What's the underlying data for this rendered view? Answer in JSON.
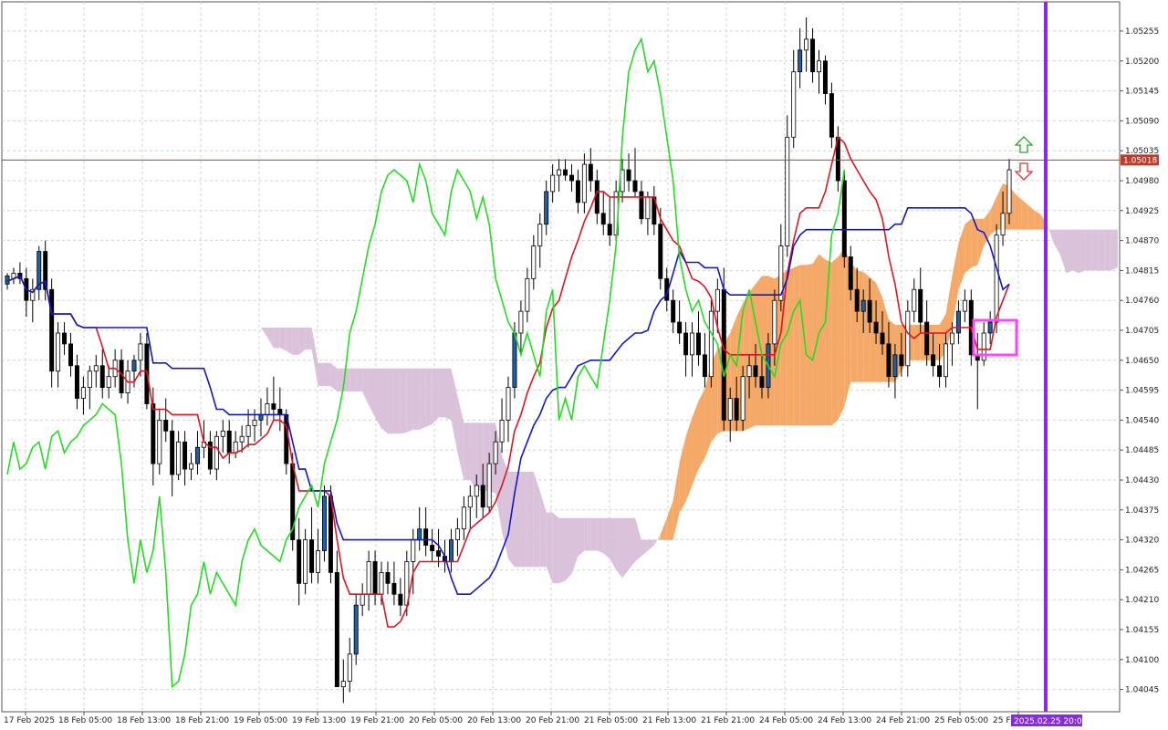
{
  "chart_data": {
    "type": "candlestick",
    "y_ticks": [
      "1.05255",
      "1.05200",
      "1.05145",
      "1.05090",
      "1.05035",
      "1.04980",
      "1.04925",
      "1.04870",
      "1.04815",
      "1.04760",
      "1.04705",
      "1.04650",
      "1.04595",
      "1.04540",
      "1.04485",
      "1.04430",
      "1.04375",
      "1.04320",
      "1.04265",
      "1.04210",
      "1.04155",
      "1.04100",
      "1.04045"
    ],
    "x_tick_labels": [
      "17 Feb 2025",
      "18 Feb 05:00",
      "18 Feb 13:00",
      "18 Feb 21:00",
      "19 Feb 05:00",
      "19 Feb 13:00",
      "19 Feb 21:00",
      "20 Feb 05:00",
      "20 Feb 13:00",
      "20 Feb 21:00",
      "21 Feb 05:00",
      "21 Feb 13:00",
      "21 Feb 21:00",
      "24 Feb 05:00",
      "24 Feb 13:00",
      "24 Feb 21:00",
      "25 Feb 05:00",
      "25 F"
    ],
    "ylim": [
      1.04,
      1.053
    ],
    "current_price": "1.05018",
    "current_time_label": "2025.02.25 20:00",
    "colors": {
      "bull": "#ffffff",
      "bear": "#000000",
      "bull_blue": "#1f5fa8",
      "kumo_bull": "#f4a460",
      "kumo_bear": "#d8bfd8",
      "tenkan": "#e0141e",
      "kijun": "#1018c8",
      "chikou": "#22dd22",
      "price_line": "#c0392b",
      "current_time_line": "#8a2be2",
      "highlight_box": "#ff44ff",
      "up_arrow": "#22aa22",
      "down_arrow": "#e03030"
    },
    "candles": [
      [
        1.0479,
        1.0481,
        1.0478,
        1.04805
      ],
      [
        1.048,
        1.0482,
        1.0479,
        1.0481
      ],
      [
        1.0481,
        1.0483,
        1.0479,
        1.048
      ],
      [
        1.048,
        1.0482,
        1.0473,
        1.0476
      ],
      [
        1.0476,
        1.048,
        1.0472,
        1.0478
      ],
      [
        1.0478,
        1.0486,
        1.0476,
        1.0485
      ],
      [
        1.0485,
        1.0487,
        1.0476,
        1.0478
      ],
      [
        1.0478,
        1.048,
        1.046,
        1.0463
      ],
      [
        1.0463,
        1.0472,
        1.046,
        1.047
      ],
      [
        1.047,
        1.0472,
        1.0466,
        1.0468
      ],
      [
        1.0468,
        1.047,
        1.0462,
        1.0464
      ],
      [
        1.0464,
        1.0466,
        1.0456,
        1.0458
      ],
      [
        1.0458,
        1.0462,
        1.0455,
        1.046
      ],
      [
        1.046,
        1.0464,
        1.0456,
        1.0463
      ],
      [
        1.0463,
        1.0466,
        1.046,
        1.0464
      ],
      [
        1.0464,
        1.0467,
        1.0458,
        1.046
      ],
      [
        1.046,
        1.0464,
        1.0458,
        1.0462
      ],
      [
        1.0462,
        1.0467,
        1.046,
        1.0465
      ],
      [
        1.0465,
        1.0467,
        1.0458,
        1.0459
      ],
      [
        1.0459,
        1.0465,
        1.0457,
        1.0463
      ],
      [
        1.0463,
        1.0466,
        1.046,
        1.0465
      ],
      [
        1.0465,
        1.047,
        1.0462,
        1.0468
      ],
      [
        1.0468,
        1.047,
        1.0456,
        1.0457
      ],
      [
        1.0457,
        1.046,
        1.0442,
        1.0446
      ],
      [
        1.0446,
        1.0456,
        1.0444,
        1.0454
      ],
      [
        1.0454,
        1.0458,
        1.045,
        1.0452
      ],
      [
        1.0452,
        1.0454,
        1.044,
        1.0444
      ],
      [
        1.0444,
        1.0452,
        1.0443,
        1.045
      ],
      [
        1.045,
        1.0452,
        1.0442,
        1.0445
      ],
      [
        1.0445,
        1.0448,
        1.0443,
        1.0446
      ],
      [
        1.0446,
        1.0452,
        1.0444,
        1.0449
      ],
      [
        1.0449,
        1.0454,
        1.0447,
        1.045
      ],
      [
        1.045,
        1.0452,
        1.0444,
        1.0445
      ],
      [
        1.0445,
        1.0452,
        1.0443,
        1.0451
      ],
      [
        1.0451,
        1.0454,
        1.0448,
        1.0452
      ],
      [
        1.0452,
        1.0454,
        1.0446,
        1.0448
      ],
      [
        1.0448,
        1.0452,
        1.0447,
        1.045
      ],
      [
        1.045,
        1.0453,
        1.0448,
        1.0451
      ],
      [
        1.0451,
        1.0456,
        1.0449,
        1.0453
      ],
      [
        1.0453,
        1.0456,
        1.045,
        1.0454
      ],
      [
        1.0454,
        1.0458,
        1.0451,
        1.0455
      ],
      [
        1.0455,
        1.046,
        1.0453,
        1.0457
      ],
      [
        1.0457,
        1.0462,
        1.0454,
        1.0456
      ],
      [
        1.0456,
        1.046,
        1.0452,
        1.0455
      ],
      [
        1.0455,
        1.0456,
        1.0444,
        1.0446
      ],
      [
        1.0446,
        1.0448,
        1.043,
        1.0432
      ],
      [
        1.0432,
        1.0436,
        1.042,
        1.0424
      ],
      [
        1.0424,
        1.0434,
        1.0422,
        1.0432
      ],
      [
        1.0432,
        1.0438,
        1.0424,
        1.0426
      ],
      [
        1.0426,
        1.0434,
        1.0424,
        1.043
      ],
      [
        1.043,
        1.0442,
        1.0428,
        1.044
      ],
      [
        1.044,
        1.0442,
        1.0424,
        1.0426
      ],
      [
        1.0426,
        1.043,
        1.0408,
        1.0405
      ],
      [
        1.0405,
        1.041,
        1.0402,
        1.0406
      ],
      [
        1.0406,
        1.0414,
        1.0404,
        1.0411
      ],
      [
        1.0411,
        1.0422,
        1.0409,
        1.042
      ],
      [
        1.042,
        1.0424,
        1.0418,
        1.0422
      ],
      [
        1.0422,
        1.043,
        1.0419,
        1.0428
      ],
      [
        1.0428,
        1.043,
        1.042,
        1.0422
      ],
      [
        1.0422,
        1.0428,
        1.042,
        1.0426
      ],
      [
        1.0426,
        1.0428,
        1.0422,
        1.0424
      ],
      [
        1.0424,
        1.0428,
        1.042,
        1.0422
      ],
      [
        1.0422,
        1.0425,
        1.0418,
        1.042
      ],
      [
        1.042,
        1.043,
        1.0418,
        1.0428
      ],
      [
        1.0428,
        1.0434,
        1.0422,
        1.0432
      ],
      [
        1.0432,
        1.0438,
        1.043,
        1.0434
      ],
      [
        1.0434,
        1.0438,
        1.0429,
        1.0431
      ],
      [
        1.0431,
        1.0434,
        1.0428,
        1.043
      ],
      [
        1.043,
        1.0434,
        1.0427,
        1.0429
      ],
      [
        1.0429,
        1.0432,
        1.0426,
        1.0428
      ],
      [
        1.0428,
        1.0434,
        1.0426,
        1.0432
      ],
      [
        1.0432,
        1.0436,
        1.0429,
        1.0434
      ],
      [
        1.0434,
        1.044,
        1.0432,
        1.0438
      ],
      [
        1.0438,
        1.0442,
        1.0434,
        1.044
      ],
      [
        1.044,
        1.0444,
        1.0436,
        1.0442
      ],
      [
        1.0442,
        1.0446,
        1.0436,
        1.0438
      ],
      [
        1.0438,
        1.0448,
        1.0437,
        1.0446
      ],
      [
        1.0446,
        1.0452,
        1.0444,
        1.045
      ],
      [
        1.045,
        1.0458,
        1.0448,
        1.0454
      ],
      [
        1.0454,
        1.0462,
        1.045,
        1.046
      ],
      [
        1.046,
        1.0472,
        1.0458,
        1.047
      ],
      [
        1.047,
        1.0476,
        1.0466,
        1.0474
      ],
      [
        1.0474,
        1.0482,
        1.0472,
        1.048
      ],
      [
        1.048,
        1.0488,
        1.0478,
        1.0486
      ],
      [
        1.0486,
        1.0492,
        1.0482,
        1.049
      ],
      [
        1.049,
        1.0498,
        1.0488,
        1.0496
      ],
      [
        1.0496,
        1.0501,
        1.0494,
        1.0499
      ],
      [
        1.0499,
        1.0502,
        1.0496,
        1.05
      ],
      [
        1.05,
        1.0502,
        1.0498,
        1.0499
      ],
      [
        1.0499,
        1.0501,
        1.0496,
        1.0498
      ],
      [
        1.0498,
        1.05,
        1.0492,
        1.0494
      ],
      [
        1.0494,
        1.0503,
        1.0492,
        1.0501
      ],
      [
        1.0501,
        1.0504,
        1.0496,
        1.0498
      ],
      [
        1.0498,
        1.05,
        1.049,
        1.0492
      ],
      [
        1.0492,
        1.0496,
        1.0488,
        1.049
      ],
      [
        1.049,
        1.0495,
        1.0486,
        1.0488
      ],
      [
        1.0488,
        1.0498,
        1.0487,
        1.0496
      ],
      [
        1.0496,
        1.0502,
        1.0494,
        1.05
      ],
      [
        1.05,
        1.0503,
        1.0496,
        1.0498
      ],
      [
        1.0498,
        1.0504,
        1.0495,
        1.0496
      ],
      [
        1.0496,
        1.0498,
        1.049,
        1.0491
      ],
      [
        1.0491,
        1.0496,
        1.0488,
        1.0495
      ],
      [
        1.0495,
        1.0497,
        1.0488,
        1.049
      ],
      [
        1.049,
        1.0493,
        1.0478,
        1.048
      ],
      [
        1.048,
        1.0482,
        1.0474,
        1.0476
      ],
      [
        1.0476,
        1.0478,
        1.047,
        1.0472
      ],
      [
        1.0472,
        1.0476,
        1.0468,
        1.047
      ],
      [
        1.047,
        1.0472,
        1.0462,
        1.0466
      ],
      [
        1.0466,
        1.0472,
        1.0462,
        1.047
      ],
      [
        1.047,
        1.0474,
        1.0464,
        1.0466
      ],
      [
        1.0466,
        1.047,
        1.046,
        1.0462
      ],
      [
        1.0462,
        1.0476,
        1.046,
        1.0474
      ],
      [
        1.0474,
        1.048,
        1.047,
        1.0478
      ],
      [
        1.0478,
        1.0482,
        1.0452,
        1.0454
      ],
      [
        1.0454,
        1.046,
        1.045,
        1.0458
      ],
      [
        1.0458,
        1.0462,
        1.0452,
        1.0454
      ],
      [
        1.0454,
        1.0464,
        1.0452,
        1.0462
      ],
      [
        1.0462,
        1.0466,
        1.0458,
        1.0464
      ],
      [
        1.0464,
        1.0468,
        1.046,
        1.0462
      ],
      [
        1.0462,
        1.0466,
        1.0458,
        1.046
      ],
      [
        1.046,
        1.047,
        1.0458,
        1.0468
      ],
      [
        1.0468,
        1.0478,
        1.0464,
        1.0476
      ],
      [
        1.0476,
        1.049,
        1.0474,
        1.0486
      ],
      [
        1.0486,
        1.051,
        1.0484,
        1.0506
      ],
      [
        1.0506,
        1.0522,
        1.0504,
        1.0518
      ],
      [
        1.0518,
        1.0526,
        1.0515,
        1.0522
      ],
      [
        1.0522,
        1.0528,
        1.0518,
        1.0524
      ],
      [
        1.0524,
        1.0526,
        1.0516,
        1.0518
      ],
      [
        1.0518,
        1.0522,
        1.0514,
        1.052
      ],
      [
        1.052,
        1.0521,
        1.0512,
        1.0514
      ],
      [
        1.0514,
        1.0516,
        1.0504,
        1.0506
      ],
      [
        1.0506,
        1.0508,
        1.0496,
        1.0498
      ],
      [
        1.0498,
        1.05,
        1.0482,
        1.0484
      ],
      [
        1.0484,
        1.0486,
        1.0476,
        1.0478
      ],
      [
        1.0478,
        1.0482,
        1.0472,
        1.0474
      ],
      [
        1.0474,
        1.0478,
        1.047,
        1.0476
      ],
      [
        1.0476,
        1.048,
        1.047,
        1.0472
      ],
      [
        1.0472,
        1.0476,
        1.0468,
        1.047
      ],
      [
        1.047,
        1.0474,
        1.0466,
        1.0468
      ],
      [
        1.0468,
        1.0472,
        1.046,
        1.0462
      ],
      [
        1.0462,
        1.0468,
        1.0458,
        1.0466
      ],
      [
        1.0466,
        1.047,
        1.0462,
        1.0464
      ],
      [
        1.0464,
        1.0476,
        1.0462,
        1.0474
      ],
      [
        1.0474,
        1.048,
        1.0472,
        1.0478
      ],
      [
        1.0478,
        1.0482,
        1.047,
        1.0472
      ],
      [
        1.0472,
        1.0476,
        1.0464,
        1.0466
      ],
      [
        1.0466,
        1.047,
        1.0462,
        1.0464
      ],
      [
        1.0464,
        1.0468,
        1.046,
        1.0462
      ],
      [
        1.0462,
        1.047,
        1.046,
        1.0468
      ],
      [
        1.0468,
        1.0472,
        1.0464,
        1.047
      ],
      [
        1.047,
        1.0476,
        1.0468,
        1.0474
      ],
      [
        1.0474,
        1.0478,
        1.0472,
        1.0476
      ],
      [
        1.0476,
        1.0478,
        1.0464,
        1.0466
      ],
      [
        1.0466,
        1.047,
        1.0456,
        1.0465
      ],
      [
        1.0465,
        1.0472,
        1.0464,
        1.047
      ],
      [
        1.047,
        1.0474,
        1.0468,
        1.0472
      ],
      [
        1.0472,
        1.049,
        1.047,
        1.0488
      ],
      [
        1.0488,
        1.0496,
        1.0486,
        1.0492
      ],
      [
        1.0492,
        1.0502,
        1.049,
        1.05
      ]
    ]
  }
}
